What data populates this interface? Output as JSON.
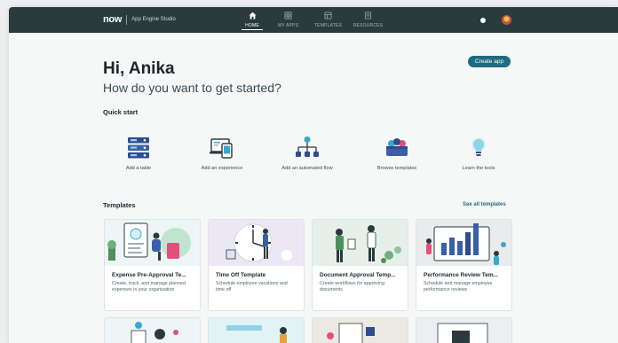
{
  "nav": {
    "brand_logo": "now",
    "brand_name": "App Engine Studio",
    "tabs": [
      {
        "label": "HOME",
        "icon": "home-icon",
        "active": true
      },
      {
        "label": "MY APPS",
        "icon": "grid-icon",
        "active": false
      },
      {
        "label": "TEMPLATES",
        "icon": "templates-icon",
        "active": false
      },
      {
        "label": "RESOURCES",
        "icon": "resources-icon",
        "active": false
      }
    ]
  },
  "hero": {
    "greeting": "Hi, Anika",
    "subtitle": "How do you want to get started?",
    "create_label": "Create app"
  },
  "quick_start": {
    "title": "Quick start",
    "items": [
      {
        "label": "Add a table",
        "icon": "table-icon"
      },
      {
        "label": "Add an experience",
        "icon": "device-icon"
      },
      {
        "label": "Add an automated flow",
        "icon": "flow-icon"
      },
      {
        "label": "Browse templates",
        "icon": "templates-bundle-icon"
      },
      {
        "label": "Learn the tools",
        "icon": "lightbulb-icon"
      }
    ]
  },
  "templates": {
    "title": "Templates",
    "see_all": "See all templates",
    "cards": [
      {
        "title": "Expense Pre-Approval Te...",
        "desc": "Create, track, and manage planned expenses in your organization"
      },
      {
        "title": "Time Off Template",
        "desc": "Schedule employee vacations and time off"
      },
      {
        "title": "Document Approval Temp...",
        "desc": "Create workflows for approving documents"
      },
      {
        "title": "Performance Review Tem...",
        "desc": "Schedule and manage employee performance reviews"
      }
    ]
  },
  "colors": {
    "nav_bg": "#2b3a3d",
    "accent": "#1f6b80",
    "page_bg": "#f6f7f7"
  }
}
